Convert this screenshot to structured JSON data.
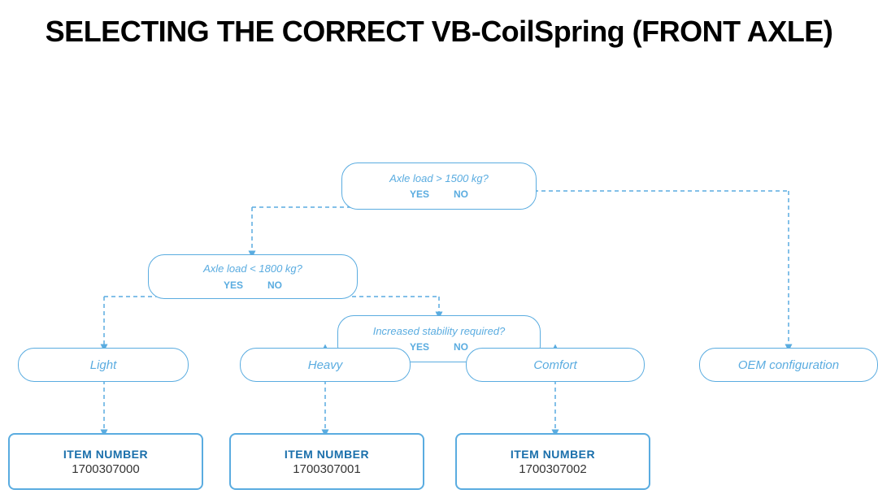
{
  "title": "SELECTING THE CORRECT VB-CoilSpring (FRONT AXLE)",
  "decision1": {
    "question": "Axle load > 1500 kg?",
    "yes": "YES",
    "no": "NO"
  },
  "decision2": {
    "question": "Axle load < 1800 kg?",
    "yes": "YES",
    "no": "NO"
  },
  "decision3": {
    "question": "Increased stability required?",
    "yes": "YES",
    "no": "NO"
  },
  "result_light": "Light",
  "result_heavy": "Heavy",
  "result_comfort": "Comfort",
  "result_oem": "OEM configuration",
  "item1": {
    "label": "ITEM NUMBER",
    "number": "1700307000"
  },
  "item2": {
    "label": "ITEM NUMBER",
    "number": "1700307001"
  },
  "item3": {
    "label": "ITEM NUMBER",
    "number": "1700307002"
  }
}
